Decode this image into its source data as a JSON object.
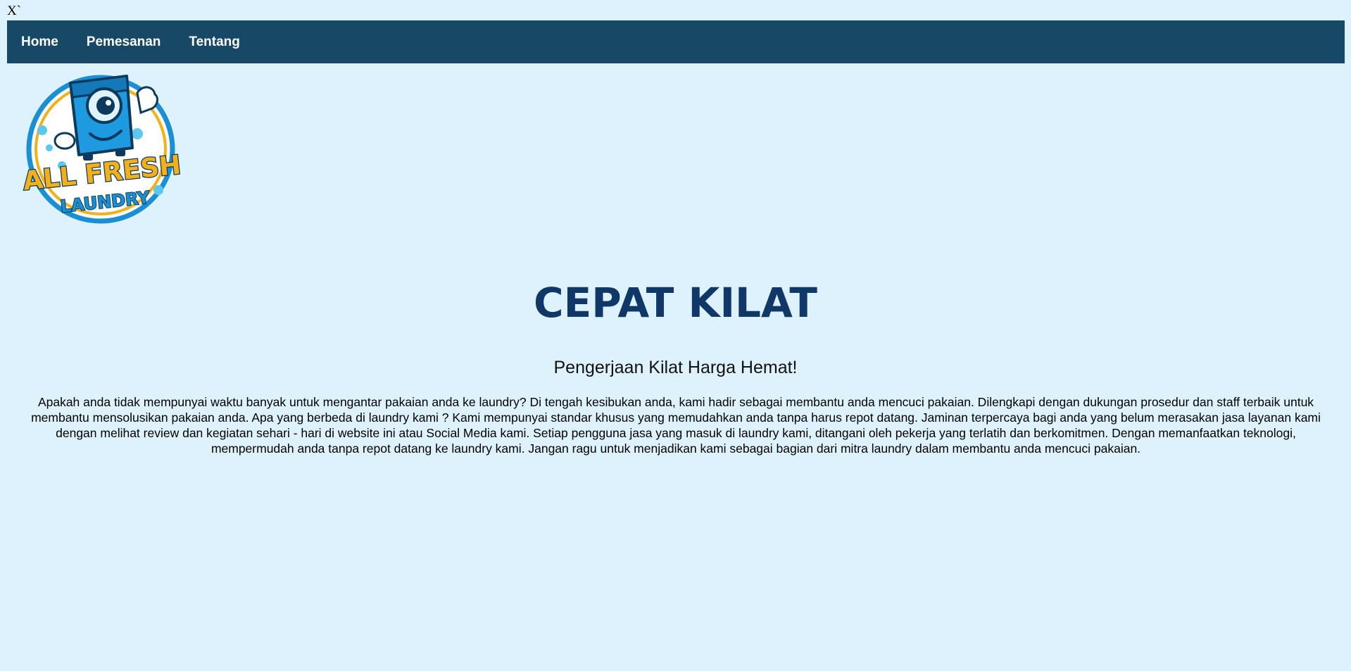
{
  "stray_text": "X`",
  "nav": {
    "items": [
      {
        "label": "Home"
      },
      {
        "label": "Pemesanan"
      },
      {
        "label": "Tentang"
      }
    ],
    "background": "#174866"
  },
  "logo": {
    "line1": "ALL FRESH",
    "line2": "LAUNDRY"
  },
  "hero": {
    "title": "CEPAT KILAT",
    "subtitle": "Pengerjaan Kilat Harga Hemat!",
    "body": "Apakah anda tidak mempunyai waktu banyak untuk mengantar pakaian anda ke laundry? Di tengah kesibukan anda, kami hadir sebagai membantu anda mencuci pakaian. Dilengkapi dengan dukungan prosedur dan staff terbaik untuk membantu mensolusikan pakaian anda. Apa yang berbeda di laundry kami ? Kami mempunyai standar khusus yang memudahkan anda tanpa harus repot datang. Jaminan terpercaya bagi anda yang belum merasakan jasa layanan kami dengan melihat review dan kegiatan sehari - hari di website ini atau Social Media kami. Setiap pengguna jasa yang masuk di laundry kami, ditangani oleh pekerja yang terlatih dan berkomitmen. Dengan memanfaatkan teknologi, mempermudah anda tanpa repot datang ke laundry kami. Jangan ragu untuk menjadikan kami sebagai bagian dari mitra laundry dalam membantu anda mencuci pakaian."
  },
  "colors": {
    "page_background": "#def2fd",
    "title": "#0f3869",
    "logo_blue": "#1e9be0",
    "logo_yellow": "#f4b019"
  }
}
